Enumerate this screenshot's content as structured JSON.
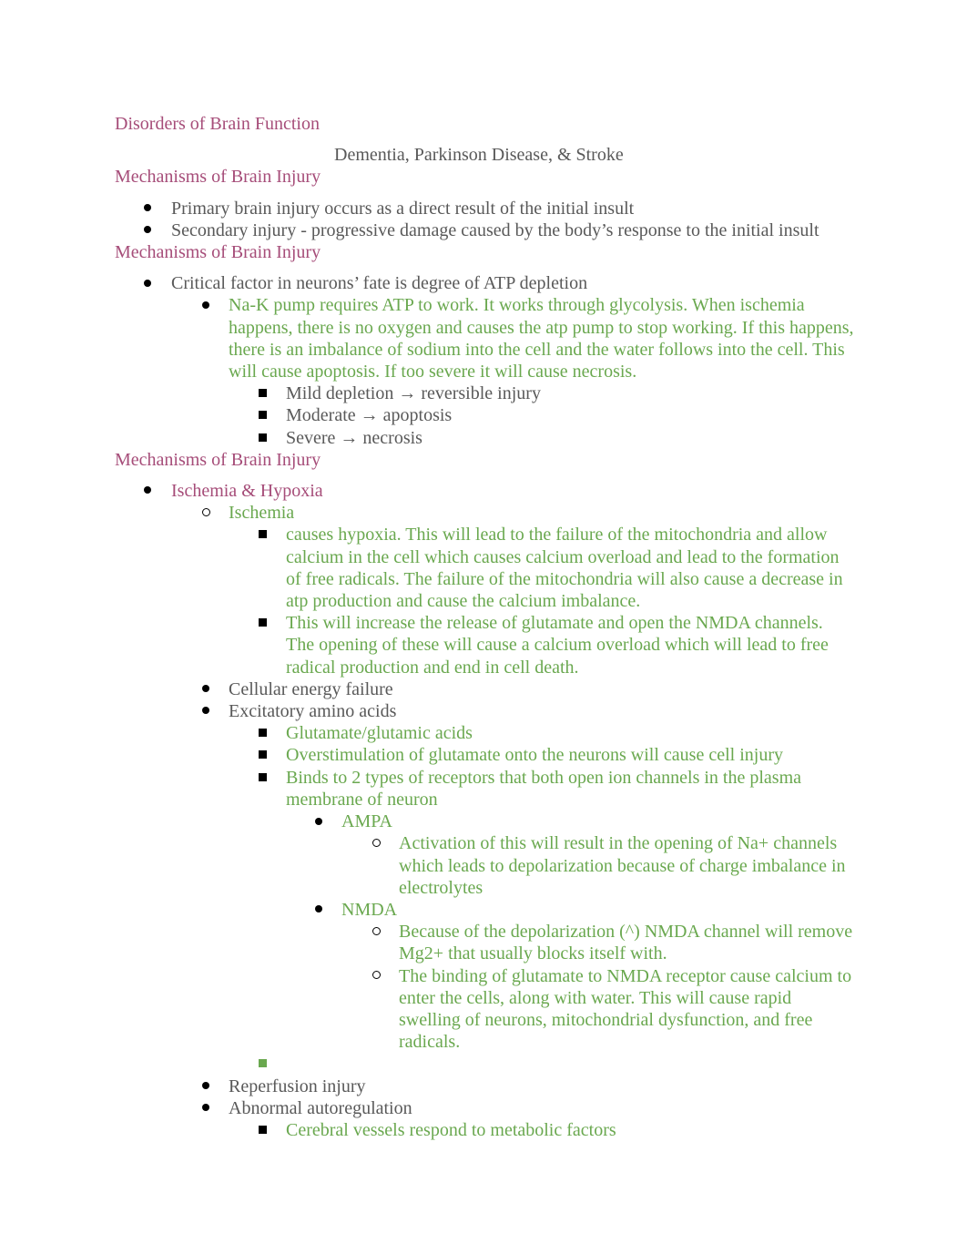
{
  "doc": {
    "title": "Disorders of Brain Function",
    "subtitle": "Dementia, Parkinson Disease, & Stroke",
    "sections": [
      {
        "heading": "Mechanisms of Brain Injury",
        "items": [
          "Primary brain injury occurs as a direct result of the initial insult",
          "Secondary injury - progressive damage caused by the body’s response to the initial insult"
        ]
      },
      {
        "heading": "Mechanisms of Brain Injury",
        "critical": "Critical factor in neurons’ fate is degree of ATP depletion",
        "nak": "Na-K pump requires ATP to work. It works through glycolysis. When ischemia happens, there is no oxygen and causes the atp pump to stop working. If this happens, there is an imbalance of sodium into the cell and the water follows into the cell. This will cause apoptosis. If too severe it will cause necrosis.",
        "levels": [
          "Mild depletion → reversible injury",
          "Moderate → apoptosis",
          "Severe → necrosis"
        ]
      },
      {
        "heading": "Mechanisms of Brain Injury",
        "ischemia_hypoxia": "Ischemia & Hypoxia",
        "ischemia": "Ischemia",
        "ischemia_notes": [
          "causes hypoxia. This will lead to the failure of the mitochondria and allow calcium in the cell which causes calcium overload and lead to the formation of free radicals. The failure of the mitochondria will also cause a decrease in atp production and cause the calcium imbalance.",
          "This will increase the release of glutamate and open the NMDA channels. The opening of these will cause a calcium overload which will lead to free radical production and end in cell death."
        ],
        "cellular": "Cellular energy failure",
        "excitatory": "Excitatory amino acids",
        "excitatory_notes": [
          "Glutamate/glutamic acids",
          "Overstimulation of glutamate onto the neurons will cause cell injury",
          "Binds to 2 types of receptors that both open ion channels in the plasma membrane of neuron"
        ],
        "ampa": "AMPA",
        "ampa_note": "Activation of this will result in the opening of Na+ channels which leads to depolarization because of charge imbalance in electrolytes",
        "nmda": "NMDA",
        "nmda_notes": [
          "Because of the depolarization (^) NMDA channel will remove Mg2+ that usually blocks itself with.",
          "The binding of glutamate to NMDA receptor cause calcium to enter the cells, along with water. This will cause rapid swelling of neurons, mitochondrial dysfunction, and free radicals."
        ],
        "reperfusion": "Reperfusion injury",
        "autoregulation": "Abnormal autoregulation",
        "autoregulation_note": "Cerebral vessels respond to metabolic factors"
      }
    ]
  }
}
